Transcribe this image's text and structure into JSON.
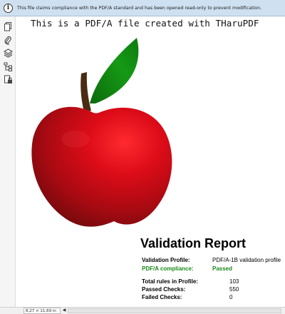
{
  "infobar": {
    "icon": "info-icon",
    "message": "This file claims compliance with the PDF/A standard and has been opened read-only to prevent modification."
  },
  "sidebar": {
    "tools": [
      {
        "name": "pages-panel-icon"
      },
      {
        "name": "attachments-icon"
      },
      {
        "name": "layers-icon"
      },
      {
        "name": "structure-tree-icon"
      },
      {
        "name": "security-lock-icon"
      }
    ],
    "collapse_glyph": "◀"
  },
  "document": {
    "heading": "This is a PDF/A file created with THaruPDF",
    "colors": {
      "apple_red": "#e0101c",
      "apple_dark": "#8a0a10",
      "leaf_green": "#128a12",
      "stem_brown": "#4a2a12"
    }
  },
  "report": {
    "title": "Validation Report",
    "profile_label": "Validation Profile:",
    "profile_value": "PDF/A-1B validation profile",
    "compliance_label": "PDF/A compliance:",
    "compliance_value": "Passed",
    "compliance_color": "#1a8a1a",
    "total_label": "Total rules in Profile:",
    "total_value": "103",
    "passed_label": "Passed Checks:",
    "passed_value": "550",
    "failed_label": "Failed Checks:",
    "failed_value": "0"
  },
  "statusbar": {
    "page_size": "8,27 × 11,69 in",
    "scroll_left_glyph": "◀"
  }
}
